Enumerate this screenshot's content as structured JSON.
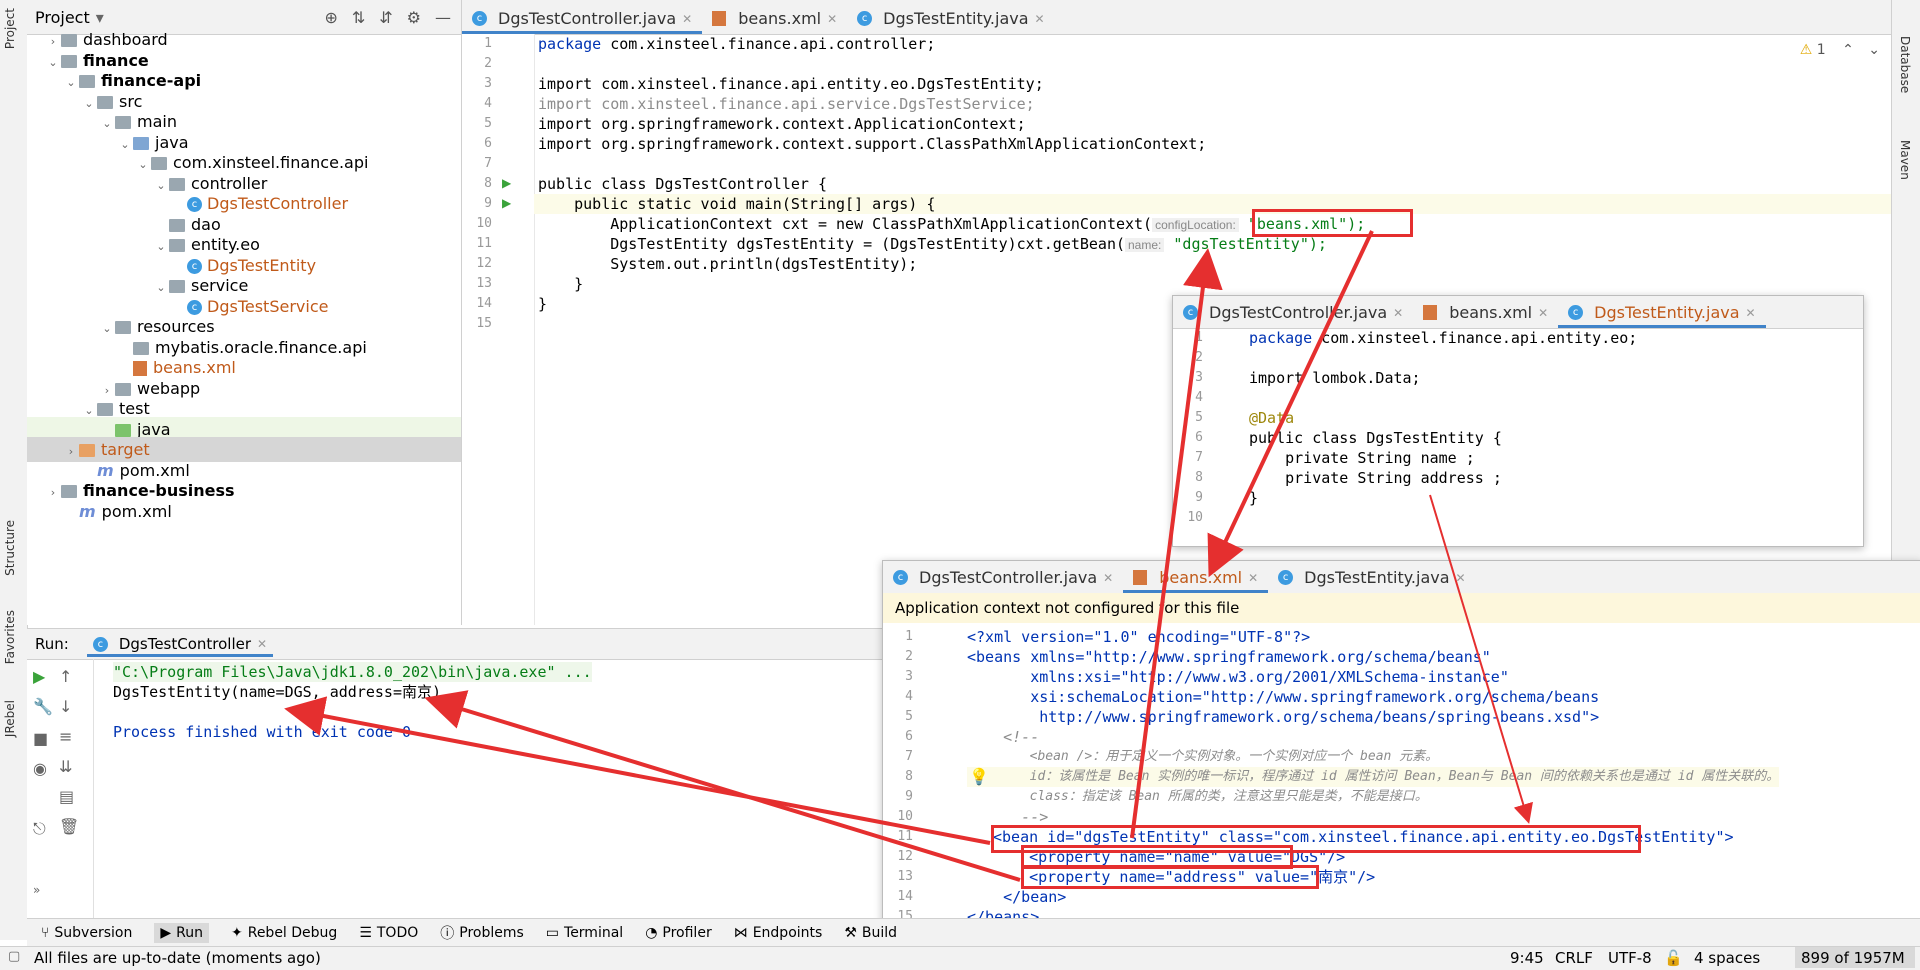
{
  "left_strip": {
    "project": "Project",
    "structure": "Structure",
    "favorites": "Favorites",
    "jrebel": "JRebel"
  },
  "right_strip": {
    "database": "Database",
    "maven": "Maven"
  },
  "project": {
    "title": "Project",
    "tree": [
      {
        "label": "dashboard",
        "style": "normal",
        "icon": "folder"
      },
      {
        "label": "finance",
        "style": "bold",
        "icon": "folder"
      },
      {
        "label": "finance-api",
        "style": "bold",
        "icon": "folder"
      },
      {
        "label": "src",
        "style": "normal",
        "icon": "folder"
      },
      {
        "label": "main",
        "style": "normal",
        "icon": "folder"
      },
      {
        "label": "java",
        "style": "normal",
        "icon": "folder-blue"
      },
      {
        "label": "com.xinsteel.finance.api",
        "style": "normal",
        "icon": "package"
      },
      {
        "label": "controller",
        "style": "normal",
        "icon": "package"
      },
      {
        "label": "DgsTestController",
        "style": "orange",
        "icon": "class"
      },
      {
        "label": "dao",
        "style": "normal",
        "icon": "package"
      },
      {
        "label": "entity.eo",
        "style": "normal",
        "icon": "package"
      },
      {
        "label": "DgsTestEntity",
        "style": "orange",
        "icon": "class"
      },
      {
        "label": "service",
        "style": "normal",
        "icon": "package"
      },
      {
        "label": "DgsTestService",
        "style": "orange",
        "icon": "class"
      },
      {
        "label": "resources",
        "style": "normal",
        "icon": "folder"
      },
      {
        "label": "mybatis.oracle.finance.api",
        "style": "normal",
        "icon": "folder"
      },
      {
        "label": "beans.xml",
        "style": "orange",
        "icon": "xml"
      },
      {
        "label": "webapp",
        "style": "normal",
        "icon": "folder"
      },
      {
        "label": "test",
        "style": "normal",
        "icon": "folder"
      },
      {
        "label": "java",
        "style": "normal",
        "icon": "folder-green"
      },
      {
        "label": "target",
        "style": "orange",
        "icon": "folder-orange"
      },
      {
        "label": "pom.xml",
        "style": "normal",
        "icon": "maven"
      },
      {
        "label": "finance-business",
        "style": "bold",
        "icon": "folder"
      },
      {
        "label": "pom.xml",
        "style": "normal",
        "icon": "maven"
      }
    ]
  },
  "editor": {
    "tabs": [
      {
        "label": "DgsTestController.java"
      },
      {
        "label": "beans.xml"
      },
      {
        "label": "DgsTestEntity.java"
      }
    ],
    "warning_count": "1",
    "lines": [
      "1",
      "2",
      "3",
      "4",
      "5",
      "6",
      "7",
      "8",
      "9",
      "10",
      "11",
      "12",
      "13",
      "14",
      "15"
    ],
    "code": {
      "l1": "package com.xinsteel.finance.api.controller;",
      "l3": "import com.xinsteel.finance.api.entity.eo.DgsTestEntity;",
      "l4": "import com.xinsteel.finance.api.service.DgsTestService;",
      "l5": "import org.springframework.context.ApplicationContext;",
      "l6": "import org.springframework.context.support.ClassPathXmlApplicationContext;",
      "l8": "public class DgsTestController {",
      "l9": "    public static void main(String[] args) {",
      "l10a": "        ApplicationContext cxt = new ClassPathXmlApplicationContext(",
      "l10hint": "configLocation:",
      "l10b": "\"beans.xml\");",
      "l11a": "        DgsTestEntity dgsTestEntity = (DgsTestEntity)cxt.getBean(",
      "l11hint": "name:",
      "l11b": "\"dgsTestEntity\");",
      "l12": "        System.out.println(dgsTestEntity);",
      "l13": "    }",
      "l14": "}"
    }
  },
  "entity_window": {
    "tabs": [
      {
        "label": "DgsTestController.java"
      },
      {
        "label": "beans.xml"
      },
      {
        "label": "DgsTestEntity.java"
      }
    ],
    "lines": [
      "1",
      "2",
      "3",
      "4",
      "5",
      "6",
      "7",
      "8",
      "9",
      "10"
    ],
    "code": {
      "l1": "package com.xinsteel.finance.api.entity.eo;",
      "l3": "import lombok.Data;",
      "l5": "@Data",
      "l6": "public class DgsTestEntity {",
      "l7": "    private String name ;",
      "l8": "    private String address ;",
      "l9": "}"
    }
  },
  "beans_window": {
    "tabs": [
      {
        "label": "DgsTestController.java"
      },
      {
        "label": "beans.xml"
      },
      {
        "label": "DgsTestEntity.java"
      }
    ],
    "banner": "Application context not configured for this file",
    "lines": [
      "1",
      "2",
      "3",
      "4",
      "5",
      "6",
      "7",
      "8",
      "9",
      "10",
      "11",
      "12",
      "13",
      "14",
      "15"
    ],
    "code": {
      "l1": "<?xml version=\"1.0\" encoding=\"UTF-8\"?>",
      "l2": "<beans xmlns=\"http://www.springframework.org/schema/beans\"",
      "l3": "       xmlns:xsi=\"http://www.w3.org/2001/XMLSchema-instance\"",
      "l4": "       xsi:schemaLocation=\"http://www.springframework.org/schema/beans",
      "l5": "        http://www.springframework.org/schema/beans/spring-beans.xsd\">",
      "l6": "    <!--",
      "l7": "        <bean />：用于定义一个实例对象。一个实例对应一个 bean 元素。",
      "l8": "        id：该属性是 Bean 实例的唯一标识，程序通过 id 属性访问 Bean，Bean与 Bean 间的依赖关系也是通过 id 属性关联的。",
      "l9": "        class：指定该 Bean 所属的类，注意这里只能是类，不能是接口。",
      "l10": "      -->",
      "l11": "<bean id=\"dgsTestEntity\" class=\"com.xinsteel.finance.api.entity.eo.DgsTestEntity\">",
      "l12": "    <property name=\"name\" value=\"DGS\"/>",
      "l13": "    <property name=\"address\" value=\"南京\"/>",
      "l14": "    </bean>",
      "l15": "</beans>"
    }
  },
  "run": {
    "label": "Run:",
    "tab": "DgsTestController",
    "out1": "\"C:\\Program Files\\Java\\jdk1.8.0_202\\bin\\java.exe\" ...",
    "out2": "DgsTestEntity(name=DGS, address=南京)",
    "out3": "Process finished with exit code 0"
  },
  "bottom_tools": [
    "Subversion",
    "Run",
    "Rebel Debug",
    "TODO",
    "Problems",
    "Terminal",
    "Profiler",
    "Endpoints",
    "Build"
  ],
  "status": {
    "message": "All files are up-to-date (moments ago)",
    "position": "9:45",
    "line_sep": "CRLF",
    "encoding": "UTF-8",
    "indent": "4 spaces",
    "memory": "899 of 1957M"
  },
  "colors": {
    "accent": "#4083c9",
    "highlight_box": "#e52f2f",
    "banner": "#fdf7dc"
  }
}
